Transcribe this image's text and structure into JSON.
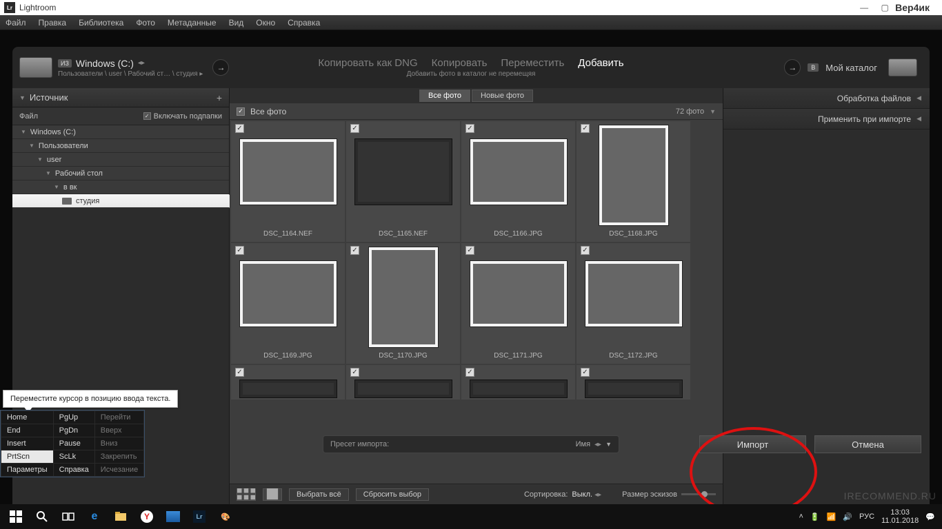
{
  "titlebar": {
    "app": "Lightroom",
    "lr": "Lr",
    "user": "Вер4ик"
  },
  "menu": [
    "Файл",
    "Правка",
    "Библиотека",
    "Фото",
    "Метаданные",
    "Вид",
    "Окно",
    "Справка"
  ],
  "source": {
    "iz": "ИЗ",
    "drive": "Windows (C:)",
    "crumbs": "Пользователи \\ user \\ Рабочий ст… \\ студия ▸"
  },
  "actions": {
    "copy_dng": "Копировать как DNG",
    "copy": "Копировать",
    "move": "Переместить",
    "add": "Добавить",
    "sub": "Добавить фото в каталог не перемещяя"
  },
  "dest": {
    "v": "В",
    "catalog": "Мой каталог"
  },
  "leftPanel": {
    "header": "Источник",
    "file_label": "Файл",
    "subfolders": "Включать подпапки",
    "tree": [
      {
        "label": "Windows (C:)",
        "indent": 12
      },
      {
        "label": "Пользователи",
        "indent": 24
      },
      {
        "label": "user",
        "indent": 36
      },
      {
        "label": "Рабочий стол",
        "indent": 48
      },
      {
        "label": "в вк",
        "indent": 60
      },
      {
        "label": "студия",
        "indent": 72,
        "selected": true
      }
    ]
  },
  "gridTabs": {
    "all": "Все фото",
    "new": "Новые фото"
  },
  "gridHeader": {
    "title": "Все фото",
    "count": "72 фото"
  },
  "thumbs": [
    {
      "file": "DSC_1164.NEF",
      "cls": "t-white"
    },
    {
      "file": "DSC_1165.NEF",
      "cls": "t-gray",
      "dim": true
    },
    {
      "file": "DSC_1166.JPG",
      "cls": "t-room"
    },
    {
      "file": "DSC_1168.JPG",
      "cls": "t-tree",
      "portrait": true
    },
    {
      "file": "DSC_1169.JPG",
      "cls": "t-flower"
    },
    {
      "file": "DSC_1170.JPG",
      "cls": "t-flower2",
      "portrait": true
    },
    {
      "file": "DSC_1171.JPG",
      "cls": "t-green"
    },
    {
      "file": "DSC_1172.JPG",
      "cls": "t-street"
    }
  ],
  "gridControls": {
    "select_all": "Выбрать всё",
    "deselect": "Сбросить выбор",
    "sort_label": "Сортировка:",
    "sort_value": "Выкл.",
    "thumb_size": "Размер эскизов"
  },
  "rightPanel": {
    "row1": "Обработка файлов",
    "row2": "Применить при импорте"
  },
  "preset": {
    "label": "Пресет импорта:",
    "name": "Имя"
  },
  "buttons": {
    "import": "Импорт",
    "cancel": "Отмена"
  },
  "tooltip": "Переместите курсор в позицию ввода текста.",
  "osk": [
    [
      "Home",
      "PgUp",
      "Перейти"
    ],
    [
      "End",
      "PgDn",
      "Вверх"
    ],
    [
      "Insert",
      "Pause",
      "Вниз"
    ],
    [
      "PrtScn",
      "ScLk",
      "Закрепить"
    ],
    [
      "Параметры",
      "Справка",
      "Исчезание"
    ]
  ],
  "tray": {
    "lang": "РУС",
    "time": "13:03",
    "date": "11.01.2018"
  },
  "watermark": "IRECOMMEND.RU"
}
